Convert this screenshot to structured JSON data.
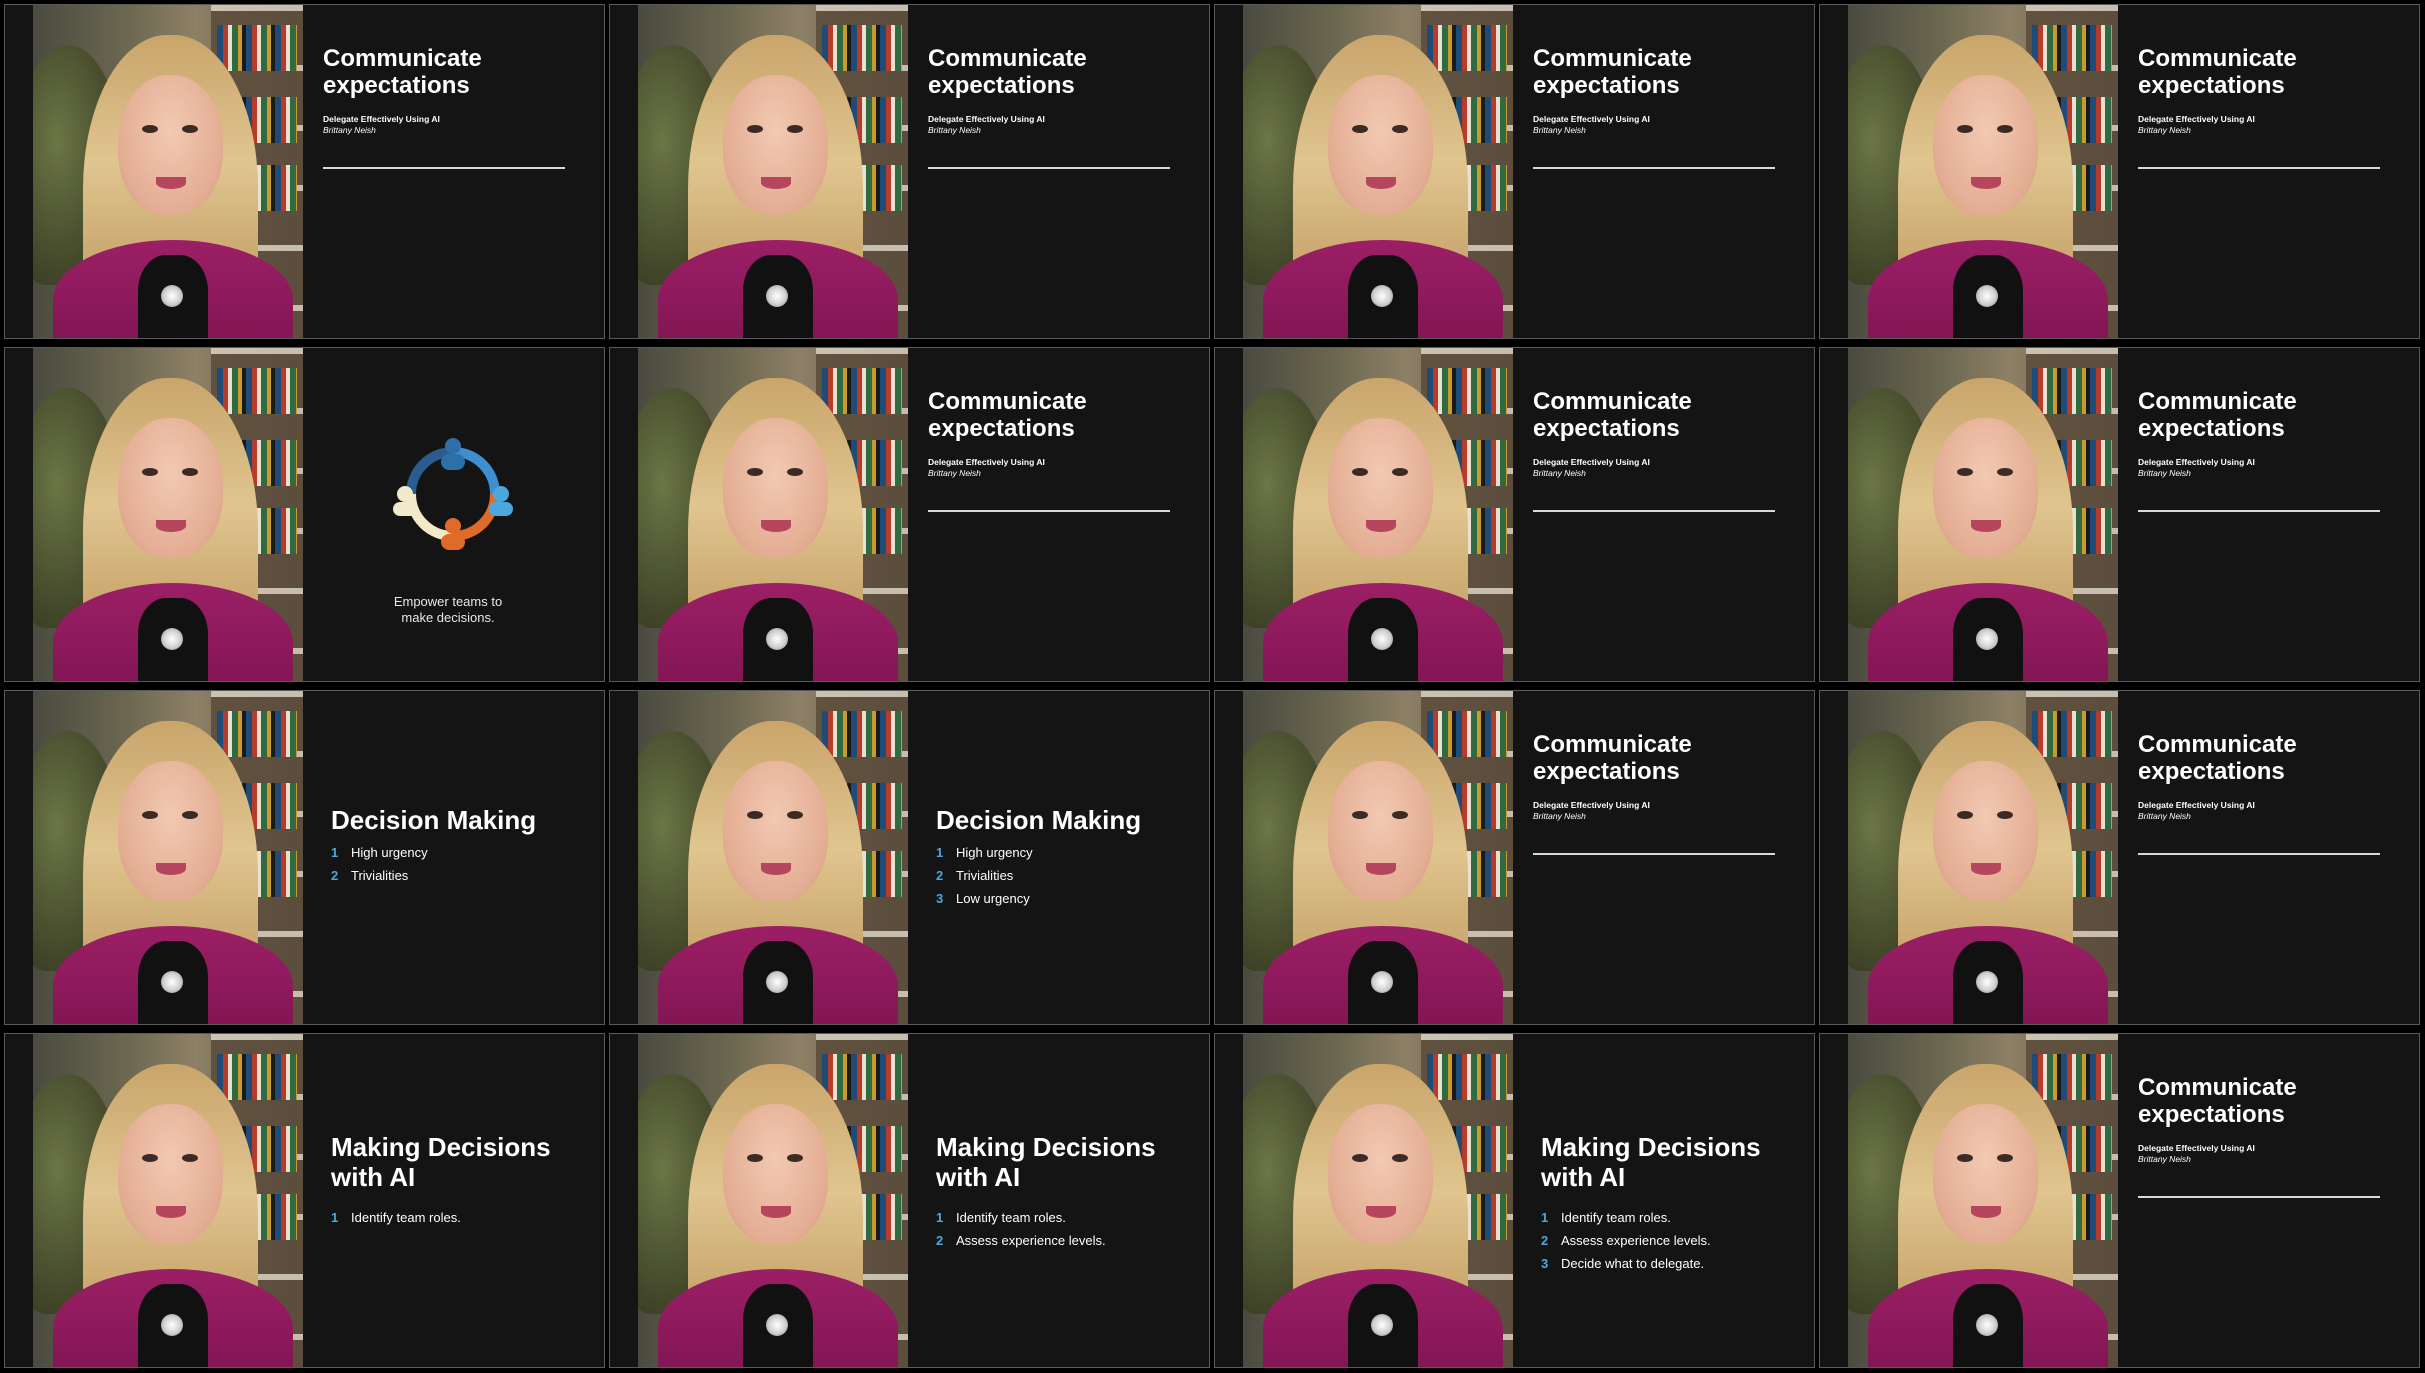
{
  "course_title": "Delegate Effectively Using AI",
  "author": "Brittany Neish",
  "thumbnails": [
    {
      "kind": "title",
      "title": "Communicate\nexpectations"
    },
    {
      "kind": "title",
      "title": "Communicate\nexpectations"
    },
    {
      "kind": "title",
      "title": "Communicate\nexpectations"
    },
    {
      "kind": "title",
      "title": "Communicate\nexpectations"
    },
    {
      "kind": "graphic",
      "caption": "Empower teams to\nmake decisions."
    },
    {
      "kind": "title",
      "title": "Communicate\nexpectations"
    },
    {
      "kind": "title",
      "title": "Communicate\nexpectations"
    },
    {
      "kind": "title",
      "title": "Communicate\nexpectations"
    },
    {
      "kind": "list",
      "heading": "Decision Making",
      "items": [
        {
          "n": "1",
          "text": "High urgency"
        },
        {
          "n": "2",
          "text": "Trivialities"
        }
      ]
    },
    {
      "kind": "list",
      "heading": "Decision Making",
      "items": [
        {
          "n": "1",
          "text": "High urgency"
        },
        {
          "n": "2",
          "text": "Trivialities"
        },
        {
          "n": "3",
          "text": "Low urgency"
        }
      ]
    },
    {
      "kind": "title",
      "title": "Communicate\nexpectations"
    },
    {
      "kind": "title",
      "title": "Communicate\nexpectations"
    },
    {
      "kind": "list",
      "heading": "Making Decisions\nwith AI",
      "items": [
        {
          "n": "1",
          "text": "Identify team roles."
        }
      ]
    },
    {
      "kind": "list",
      "heading": "Making Decisions\nwith AI",
      "items": [
        {
          "n": "1",
          "text": "Identify team roles."
        },
        {
          "n": "2",
          "text": "Assess experience levels."
        }
      ]
    },
    {
      "kind": "list",
      "heading": "Making Decisions\nwith AI",
      "items": [
        {
          "n": "1",
          "text": "Identify team roles."
        },
        {
          "n": "2",
          "text": "Assess experience levels."
        },
        {
          "n": "3",
          "text": "Decide what to delegate."
        }
      ]
    },
    {
      "kind": "title",
      "title": "Communicate\nexpectations"
    }
  ],
  "colors": {
    "accent_number": "#4aa8de",
    "slide_bg": "#141414",
    "jacket": "#9c1f66"
  }
}
